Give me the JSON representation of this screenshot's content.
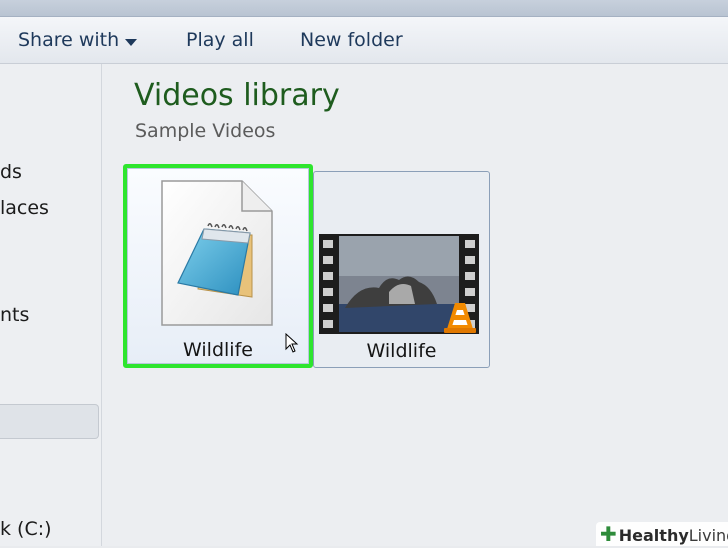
{
  "toolbar": {
    "share_with": "Share with",
    "play_all": "Play all",
    "new_folder": "New folder"
  },
  "nav_pane": {
    "items": [
      "ds",
      "laces",
      "nts",
      "k (C:)"
    ]
  },
  "library": {
    "title": "Videos library",
    "subtitle": "Sample Videos"
  },
  "files": [
    {
      "name": "Wildlife",
      "icon": "notepad-document-icon",
      "selected": true
    },
    {
      "name": "Wildlife",
      "icon": "video-thumbnail-icon",
      "selected": false
    }
  ],
  "watermark": {
    "brand_bold": "Healthy",
    "brand_light": "Living"
  },
  "colors": {
    "title_green": "#1e5c1e",
    "selection_highlight": "#2ee52e",
    "toolbar_text": "#1e395b"
  }
}
